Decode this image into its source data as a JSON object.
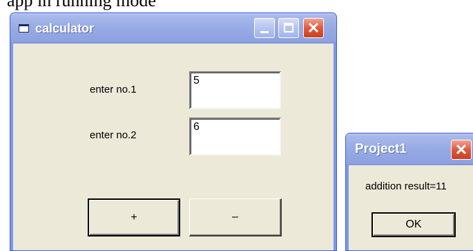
{
  "header_text": "app in running mode",
  "calculator_window": {
    "title": "calculator",
    "label_no1": "enter no.1",
    "value_no1": "5",
    "label_no2": "enter no.2",
    "value_no2": "6",
    "add_button": "+",
    "subtract_button": "–"
  },
  "message_box": {
    "title": "Project1",
    "message": "addition result=11",
    "ok_button": "OK"
  }
}
